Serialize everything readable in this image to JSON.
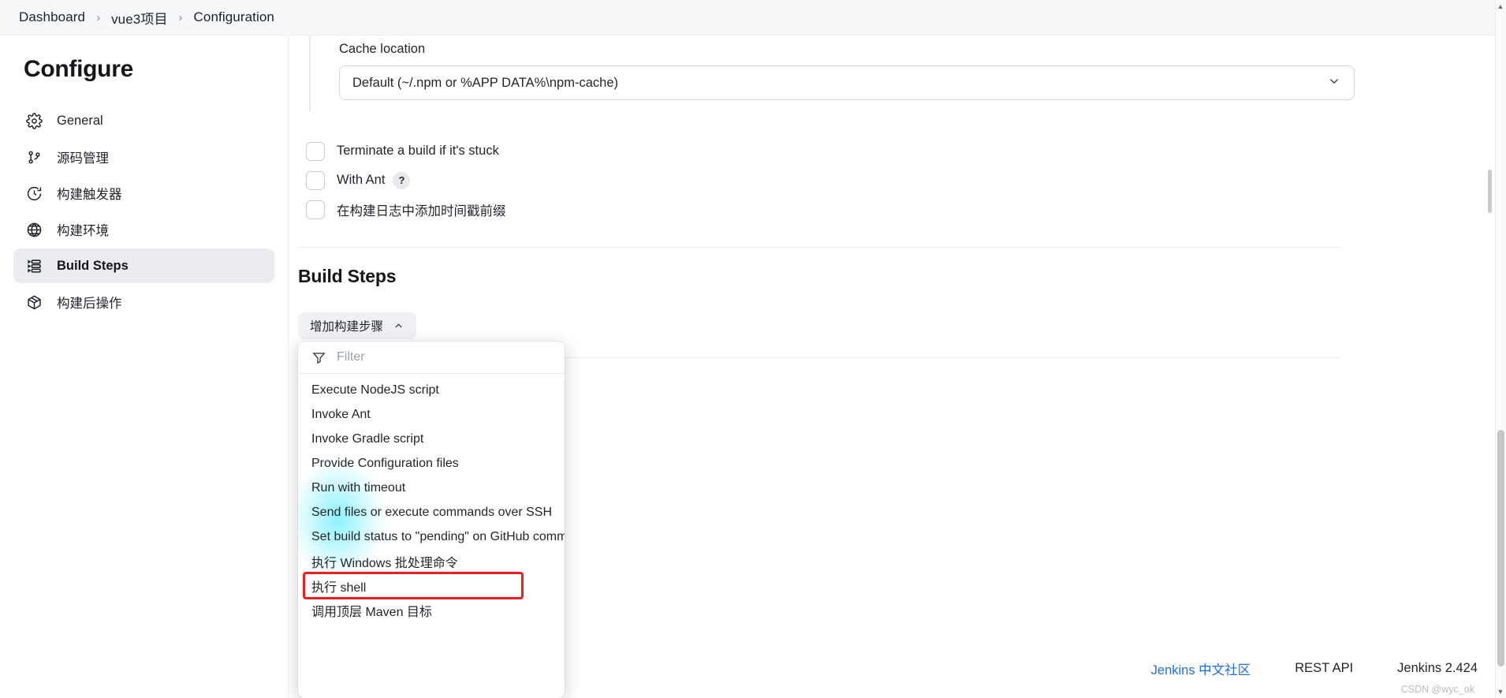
{
  "breadcrumb": {
    "items": [
      {
        "label": "Dashboard",
        "icon": "none"
      },
      {
        "label": "vue3项目",
        "icon": "none"
      },
      {
        "label": "Configuration",
        "icon": "none"
      }
    ],
    "separator": "›"
  },
  "sidebar": {
    "title": "Configure",
    "items": [
      {
        "label": "General",
        "icon": "gear-icon",
        "active": false
      },
      {
        "label": "源码管理",
        "icon": "git-branch-icon",
        "active": false
      },
      {
        "label": "构建触发器",
        "icon": "clock-icon",
        "active": false
      },
      {
        "label": "构建环境",
        "icon": "globe-icon",
        "active": false
      },
      {
        "label": "Build Steps",
        "icon": "list-steps-icon",
        "active": true
      },
      {
        "label": "构建后操作",
        "icon": "package-icon",
        "active": false
      }
    ]
  },
  "main": {
    "cache": {
      "label": "Cache location",
      "selected": "Default (~/.npm or %APP  DATA%\\npm-cache)"
    },
    "checkboxes": [
      {
        "label": "Terminate a build if it's stuck",
        "checked": false,
        "help": false
      },
      {
        "label": "With Ant",
        "checked": false,
        "help": true,
        "help_label": "?"
      },
      {
        "label": "在构建日志中添加时间戳前缀",
        "checked": false,
        "help": false
      }
    ],
    "build_steps": {
      "heading": "Build Steps",
      "add_button_label": "增加构建步骤",
      "dropdown": {
        "filter_placeholder": "Filter",
        "items": [
          {
            "label": "Execute NodeJS script",
            "highlighted": false
          },
          {
            "label": "Invoke Ant",
            "highlighted": false
          },
          {
            "label": "Invoke Gradle script",
            "highlighted": false
          },
          {
            "label": "Provide Configuration files",
            "highlighted": false
          },
          {
            "label": "Run with timeout",
            "highlighted": false
          },
          {
            "label": "Send files or execute commands over SSH",
            "highlighted": false
          },
          {
            "label": "Set build status to \"pending\" on GitHub commit",
            "highlighted": false
          },
          {
            "label": "执行 Windows 批处理命令",
            "highlighted": false
          },
          {
            "label": "执行 shell",
            "highlighted": true
          },
          {
            "label": "调用顶层 Maven 目标",
            "highlighted": false
          }
        ]
      }
    }
  },
  "footer": {
    "links": [
      {
        "label": "Jenkins 中文社区",
        "style": "blue"
      },
      {
        "label": "REST API",
        "style": "plain"
      },
      {
        "label": "Jenkins 2.424",
        "style": "plain"
      }
    ],
    "watermark": "CSDN @wyc_ok"
  },
  "colors": {
    "accent_red": "#f01e1e",
    "link_blue": "#1f6feb",
    "active_bg": "#ebecf1",
    "glow_cyan": "#78f0ff"
  }
}
